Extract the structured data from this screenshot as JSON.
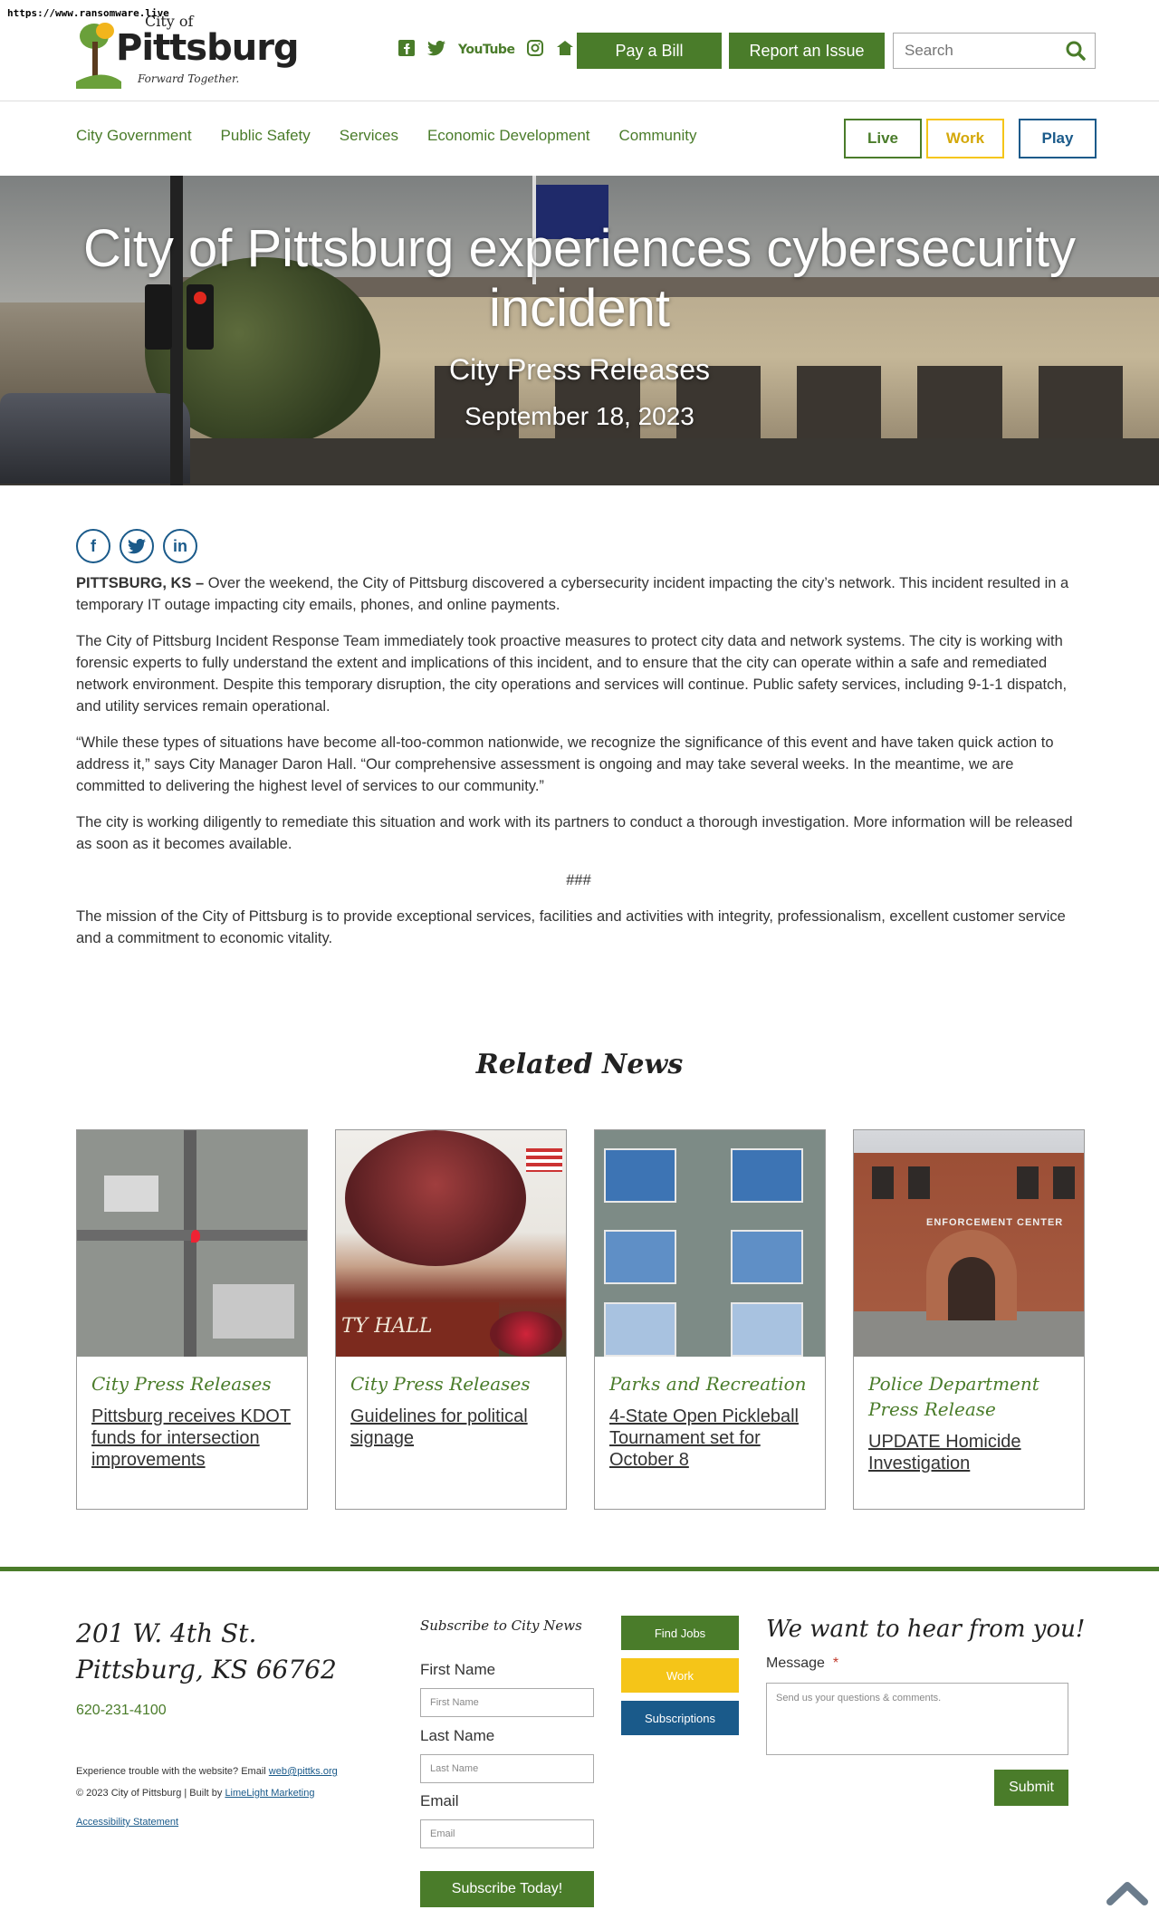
{
  "url_tag": "https://www.ransomware.live",
  "logo": {
    "city_of": "City of",
    "name": "Pittsburg",
    "tagline": "Forward Together."
  },
  "header": {
    "social_icons": [
      "facebook-icon",
      "twitter-icon",
      "youtube-icon",
      "instagram-icon",
      "home-icon"
    ],
    "youtube_label": "YouTube",
    "pay_bill": "Pay a Bill",
    "report_issue": "Report an Issue",
    "search_placeholder": "Search"
  },
  "nav": {
    "items": [
      "City Government",
      "Public Safety",
      "Services",
      "Economic Development",
      "Community"
    ],
    "live": "Live",
    "work": "Work",
    "play": "Play"
  },
  "hero": {
    "title": "City of Pittsburg experiences cybersecurity incident",
    "category": "City Press Releases",
    "date": "September 18, 2023"
  },
  "share": {
    "facebook": "f",
    "twitter": "t",
    "linkedin": "in"
  },
  "article": {
    "lead_bold": "PITTSBURG, KS –",
    "p1": " Over the weekend, the City of Pittsburg discovered a cybersecurity incident impacting the city’s network. This incident resulted in a temporary IT outage impacting city emails, phones, and online payments.",
    "p2": "The City of Pittsburg Incident Response Team immediately took proactive measures to protect city data and network systems. The city is working with forensic experts to fully understand the extent and implications of this incident, and to ensure that the city can operate within a safe and remediated network environment. Despite this temporary disruption, the city operations and services will continue. Public safety services, including 9-1-1 dispatch, and utility services remain operational.",
    "p3": "“While these types of situations have become all-too-common nationwide, we recognize the significance of this event and have taken quick action to address it,” says City Manager Daron Hall. “Our comprehensive assessment is ongoing and may take several weeks. In the meantime, we are committed to delivering the highest level of services to our community.”",
    "p4": "The city is working diligently to remediate this situation and work with its partners to conduct a thorough investigation. More information will be released as soon as it becomes available.",
    "divider": "###",
    "p5": "The mission of the City of Pittsburg is to provide exceptional services, facilities and activities with integrity, professionalism, excellent customer service and a commitment to economic vitality."
  },
  "related": {
    "heading": "Related News",
    "cards": [
      {
        "category": "City Press Releases",
        "title": "Pittsburg receives KDOT funds for intersection improvements"
      },
      {
        "category": "City Press Releases",
        "title": "Guidelines for political signage",
        "image_text": "TY HALL"
      },
      {
        "category": "Parks and Recreation",
        "title": "4-State Open Pickleball Tournament set for October 8"
      },
      {
        "category": "Police Department Press Release",
        "title": "UPDATE Homicide Investigation",
        "image_text": "ENFORCEMENT CENTER"
      }
    ]
  },
  "footer": {
    "address_line1": "201 W. 4th St.",
    "address_line2": "Pittsburg, KS 66762",
    "phone": "620-231-4100",
    "trouble_text": "Experience trouble with the website? Email ",
    "trouble_email": "web@pittks.org",
    "copyright": "© 2023 City of Pittsburg | Built by ",
    "builder": "LimeLight Marketing",
    "accessibility": "Accessibility Statement",
    "subscribe_title": "Subscribe to City News",
    "first_name_label": "First Name",
    "first_name_placeholder": "First Name",
    "last_name_label": "Last Name",
    "last_name_placeholder": "Last Name",
    "email_label": "Email",
    "email_placeholder": "Email",
    "subscribe_button": "Subscribe Today!",
    "find_jobs": "Find Jobs",
    "work": "Work",
    "subscriptions": "Subscriptions",
    "hear_title": "We want to hear from you!",
    "message_label": "Message",
    "required_mark": "*",
    "message_placeholder": "Send us your questions & comments.",
    "submit": "Submit"
  },
  "colors": {
    "green": "#4a7c2a",
    "yellow": "#f5c518",
    "blue": "#1a5a8a"
  }
}
